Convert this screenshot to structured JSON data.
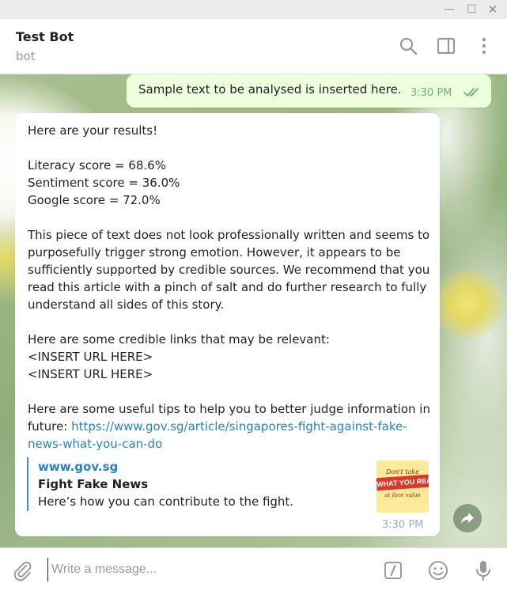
{
  "window": {
    "minimize_glyph": "—",
    "maximize_glyph": "☐",
    "close_glyph": "✕"
  },
  "chat": {
    "title": "Test Bot",
    "status": "bot"
  },
  "header_icons": [
    "search-icon",
    "side-panel-icon",
    "more-vertical-icon"
  ],
  "outgoing": {
    "text": "Sample text to be analysed is inserted here.",
    "time": "3:30 PM",
    "status_icon": "double-check-icon"
  },
  "incoming": {
    "intro": "Here are your results!",
    "scores": [
      "Literacy score = 68.6%",
      "Sentiment score = 36.0%",
      "Google score = 72.0%"
    ],
    "analysis": "This piece of text does not look professionally written and seems to purposefully trigger strong emotion. However, it appears to be sufficiently supported by credible sources. We recommend that you read this article with a pinch of salt and do further research to fully understand all sides of this story.",
    "links_heading": "Here are some credible links that may be relevant:",
    "links": [
      "<INSERT URL HERE>",
      "<INSERT URL HERE>"
    ],
    "tips_text": "Here are some useful tips to help you to better judge information in future: ",
    "tips_url": "https://www.gov.sg/article/singapores-fight-against-fake-news-what-you-can-do",
    "time": "3:30 PM"
  },
  "link_preview": {
    "site": "www.gov.sg",
    "title": "Fight Fake News",
    "description": "Here’s how you can contribute to the fight.",
    "thumb_line1": "Don't take",
    "thumb_line2": "WHAT YOU READ",
    "thumb_line3": "at face value"
  },
  "composer": {
    "placeholder": "Write a message..."
  },
  "colors": {
    "outgoing_bubble": "#eeffde",
    "link": "#2481cc",
    "time_outgoing": "#6cb16a",
    "preview_bar": "#3a8fd0"
  }
}
